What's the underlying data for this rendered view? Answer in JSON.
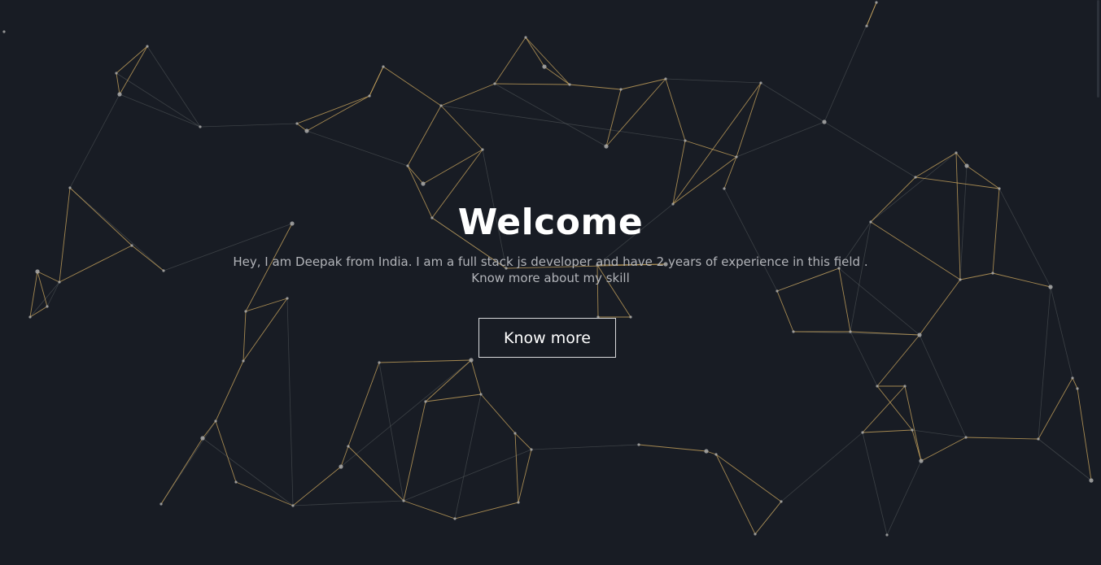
{
  "hero": {
    "title": "Welcome",
    "description_line1": "Hey, I am Deepak from India. I am a full stack js developer and have 2 years of experience in this field .",
    "description_line2": "Know more about my skill",
    "cta_label": "Know more"
  },
  "colors": {
    "background": "#181c24",
    "link_accent": "#c8a45c",
    "link_dim": "#5a5e60",
    "node": "#a9a9a9",
    "title": "#ffffff",
    "text_muted": "#b2b4b9",
    "button_border": "#d9dadc"
  },
  "background_effect": "particle-network"
}
